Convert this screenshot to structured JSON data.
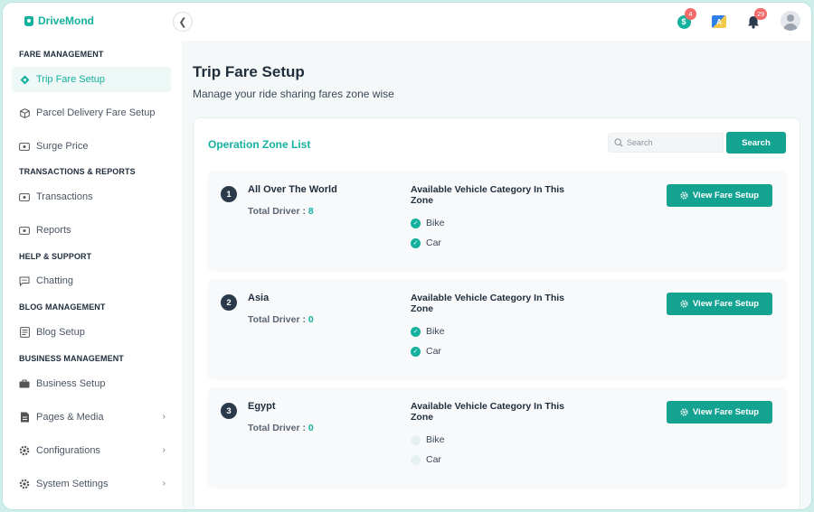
{
  "app": {
    "logo_text": "DriveMond"
  },
  "header": {
    "wallet_badge": "4",
    "wallet_icon_text": "$",
    "lang_icon_text": "A",
    "notification_badge": "29"
  },
  "sidebar": {
    "sections": [
      {
        "title": "FARE MANAGEMENT"
      },
      {
        "title": "TRANSACTIONS & REPORTS"
      },
      {
        "title": "HELP & SUPPORT"
      },
      {
        "title": "BLOG MANAGEMENT"
      },
      {
        "title": "BUSINESS MANAGEMENT"
      }
    ],
    "items": [
      {
        "label": "Trip Fare Setup",
        "icon": "diamond-icon",
        "active": true
      },
      {
        "label": "Parcel Delivery Fare Setup",
        "icon": "box-icon"
      },
      {
        "label": "Surge Price",
        "icon": "ticket-icon"
      },
      {
        "label": "Transactions",
        "icon": "wallet-icon"
      },
      {
        "label": "Reports",
        "icon": "report-icon"
      },
      {
        "label": "Chatting",
        "icon": "chat-icon"
      },
      {
        "label": "Blog Setup",
        "icon": "blog-icon"
      },
      {
        "label": "Business Setup",
        "icon": "briefcase-icon"
      },
      {
        "label": "Pages & Media",
        "icon": "pages-icon",
        "chevron": true
      },
      {
        "label": "Configurations",
        "icon": "gear-icon",
        "chevron": true
      },
      {
        "label": "System Settings",
        "icon": "settings-icon",
        "chevron": true
      }
    ]
  },
  "page": {
    "title": "Trip Fare Setup",
    "subtitle": "Manage your ride sharing fares zone wise"
  },
  "zone_list": {
    "title": "Operation Zone List",
    "search_placeholder": "Search",
    "search_button": "Search",
    "driver_label": "Total Driver : ",
    "vehicle_title": "Available Vehicle Category In This Zone",
    "view_button": "View Fare Setup",
    "zones": [
      {
        "number": "1",
        "name": "All Over The World",
        "drivers": "8",
        "vehicles": [
          {
            "name": "Bike",
            "available": true
          },
          {
            "name": "Car",
            "available": true
          }
        ]
      },
      {
        "number": "2",
        "name": "Asia",
        "drivers": "0",
        "vehicles": [
          {
            "name": "Bike",
            "available": true
          },
          {
            "name": "Car",
            "available": true
          }
        ]
      },
      {
        "number": "3",
        "name": "Egypt",
        "drivers": "0",
        "vehicles": [
          {
            "name": "Bike",
            "available": false
          },
          {
            "name": "Car",
            "available": false
          }
        ]
      }
    ]
  },
  "colors": {
    "accent": "#14b19e",
    "button": "#14a390",
    "dark": "#1f2d3d",
    "badge": "#f46a6a"
  }
}
